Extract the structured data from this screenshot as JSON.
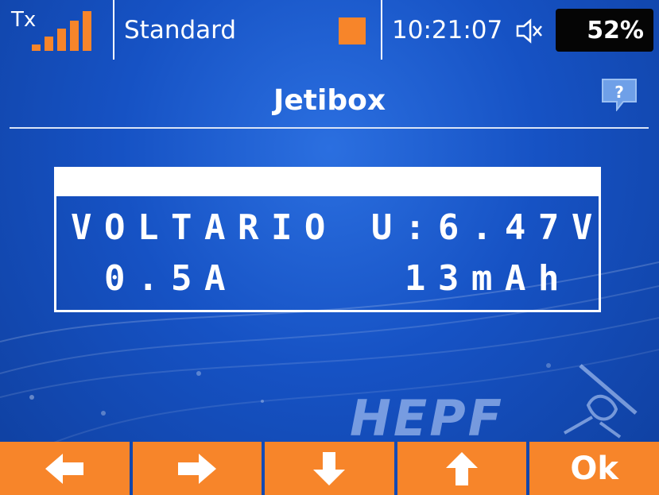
{
  "statusbar": {
    "tx_label": "Tx",
    "model_name": "Standard",
    "time": "10:21:07",
    "battery_percent": "52%",
    "signal_level": 4,
    "mute_icon": "speaker-muted-icon"
  },
  "screen": {
    "title": "Jetibox",
    "help_icon": "help-icon"
  },
  "jetibox": {
    "line1": "VOLTARIO U:6.47V",
    "line2": " 0.5A     13mAh"
  },
  "logo": {
    "text": "HEPF"
  },
  "buttons": [
    {
      "icon": "arrow-left-icon"
    },
    {
      "icon": "arrow-right-icon"
    },
    {
      "icon": "arrow-down-icon"
    },
    {
      "icon": "arrow-up-icon"
    },
    {
      "label": "Ok"
    }
  ],
  "colors": {
    "accent": "#f7852a",
    "background": "#1652c4",
    "battery_bg": "#050505"
  }
}
